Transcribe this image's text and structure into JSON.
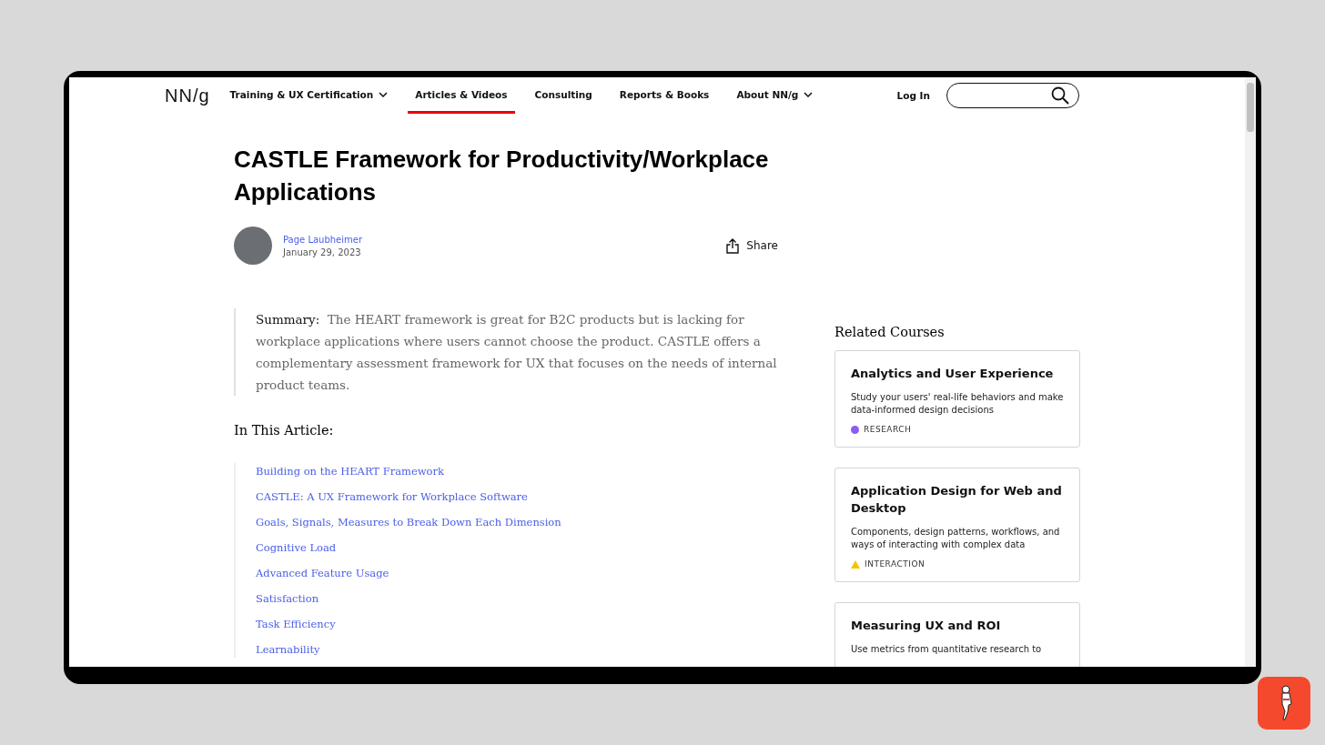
{
  "logo": "NN/g",
  "nav": [
    {
      "label": "Training & UX Certification",
      "dropdown": true,
      "selected": false
    },
    {
      "label": "Articles & Videos",
      "dropdown": false,
      "selected": true
    },
    {
      "label": "Consulting",
      "dropdown": false,
      "selected": false
    },
    {
      "label": "Reports & Books",
      "dropdown": false,
      "selected": false
    },
    {
      "label": "About NN/g",
      "dropdown": true,
      "selected": false
    }
  ],
  "login": "Log In",
  "article": {
    "title": "CASTLE Framework for Productivity/Workplace Applications",
    "author": "Page Laubheimer",
    "date": "January 29, 2023",
    "share": "Share",
    "summary_label": "Summary:",
    "summary": "The HEART framework is great for B2C products but is lacking for workplace applications where users cannot choose the product. CASTLE offers a complementary assessment framework for UX that focuses on the needs of internal product teams.",
    "toc_heading": "In This Article:",
    "toc": [
      "Building on the HEART Framework",
      "CASTLE: A UX Framework for Workplace Software",
      "Goals, Signals, Measures to Break Down Each Dimension",
      "Cognitive Load",
      "Advanced Feature Usage",
      "Satisfaction",
      "Task Efficiency",
      "Learnability"
    ]
  },
  "related": {
    "heading": "Related Courses",
    "courses": [
      {
        "title": "Analytics and User Experience",
        "description": "Study your users' real-life behaviors and make data-informed design decisions",
        "tag": "RESEARCH",
        "kind": "dot",
        "color": "#8b5cf6"
      },
      {
        "title": "Application Design for Web and Desktop",
        "description": "Components, design patterns, workflows, and ways of interacting with complex data",
        "tag": "INTERACTION",
        "kind": "triangle",
        "color": "#f5c400"
      },
      {
        "title": "Measuring UX and ROI",
        "description": "Use metrics from quantitative research to"
      }
    ]
  }
}
